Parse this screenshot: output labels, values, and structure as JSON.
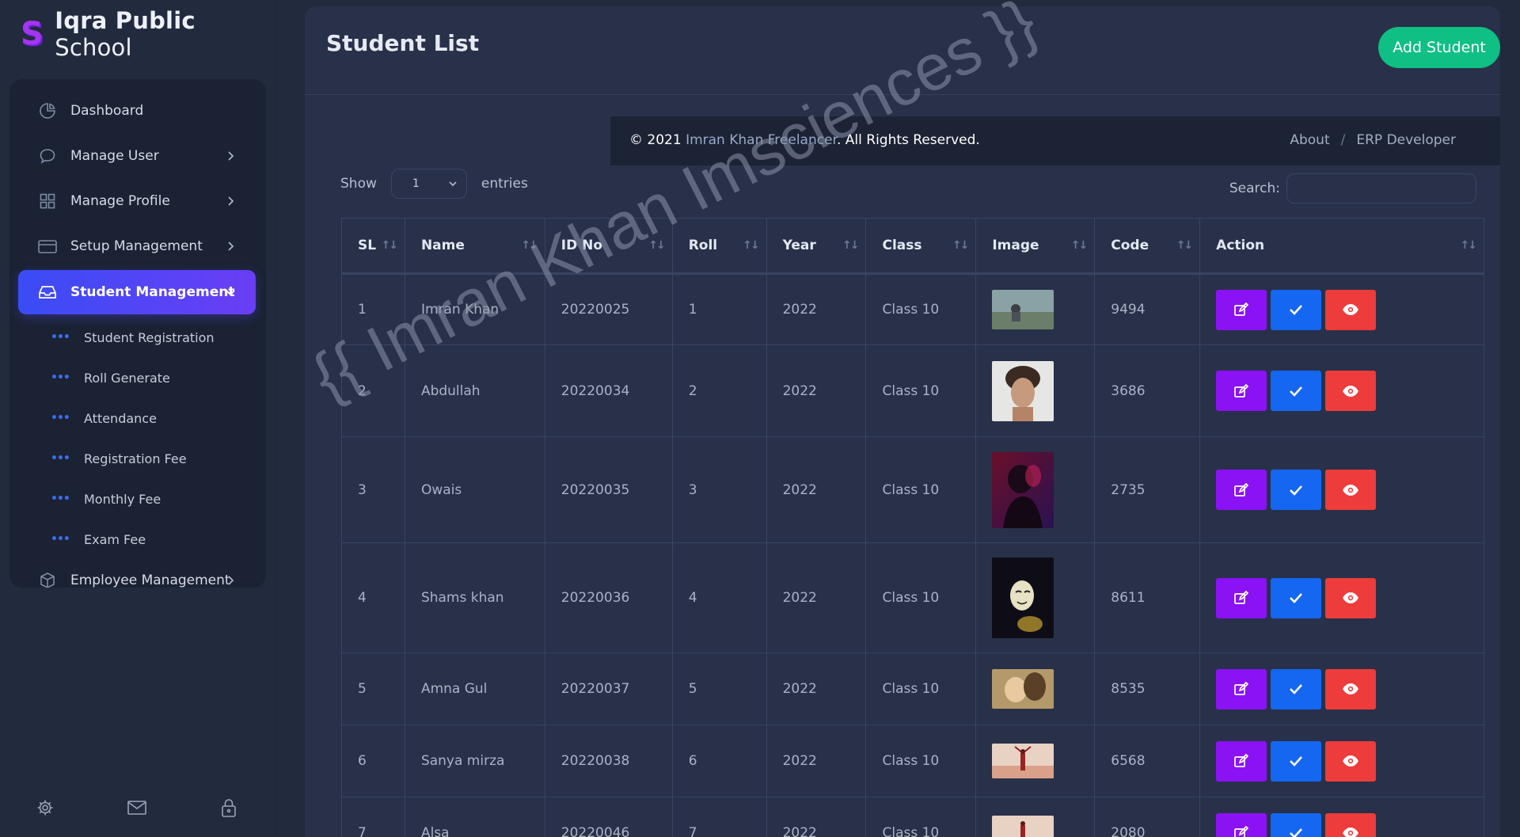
{
  "brand": {
    "logo_letter": "S",
    "name_bold": "Iqra Public",
    "name_light": " School"
  },
  "sidebar": {
    "items": [
      {
        "label": "Dashboard",
        "icon": "pie-chart-icon"
      },
      {
        "label": "Manage User",
        "icon": "chat-bubble-icon"
      },
      {
        "label": "Manage Profile",
        "icon": "grid-icon"
      },
      {
        "label": "Setup Management",
        "icon": "credit-card-icon"
      },
      {
        "label": "Student Management",
        "icon": "inbox-icon"
      },
      {
        "label": "Employee Management",
        "icon": "box-icon"
      }
    ],
    "subitems": [
      "Student Registration",
      "Roll Generate",
      "Attendance",
      "Registration Fee",
      "Monthly Fee",
      "Exam Fee"
    ],
    "bottom_icons": [
      "settings-icon",
      "mail-icon",
      "lock-icon"
    ]
  },
  "header": {
    "title": "Student List",
    "add_button": "Add Student"
  },
  "footer": {
    "copy_prefix": "© 2021 ",
    "copy_link": "Imran Khan Freelancer",
    "copy_suffix": ". All Rights Reserved.",
    "about": "About",
    "sep": "/",
    "erp": "ERP Developer"
  },
  "controls": {
    "show_label": "Show",
    "entries_value": "1",
    "entries_label": "entries",
    "search_label": "Search:"
  },
  "table": {
    "columns": [
      "SL",
      "Name",
      "ID No",
      "Roll",
      "Year",
      "Class",
      "Image",
      "Code",
      "Action"
    ],
    "rows": [
      {
        "sl": "1",
        "name": "Imran Khan",
        "id": "20220025",
        "roll": "1",
        "year": "2022",
        "class": "Class 10",
        "code": "9494"
      },
      {
        "sl": "2",
        "name": "Abdullah",
        "id": "20220034",
        "roll": "2",
        "year": "2022",
        "class": "Class 10",
        "code": "3686"
      },
      {
        "sl": "3",
        "name": "Owais",
        "id": "20220035",
        "roll": "3",
        "year": "2022",
        "class": "Class 10",
        "code": "2735"
      },
      {
        "sl": "4",
        "name": "Shams khan",
        "id": "20220036",
        "roll": "4",
        "year": "2022",
        "class": "Class 10",
        "code": "8611"
      },
      {
        "sl": "5",
        "name": "Amna Gul",
        "id": "20220037",
        "roll": "5",
        "year": "2022",
        "class": "Class 10",
        "code": "8535"
      },
      {
        "sl": "6",
        "name": "Sanya mirza",
        "id": "20220038",
        "roll": "6",
        "year": "2022",
        "class": "Class 10",
        "code": "6568"
      },
      {
        "sl": "7",
        "name": "Alsa",
        "id": "20220046",
        "roll": "7",
        "year": "2022",
        "class": "Class 10",
        "code": "2080"
      }
    ]
  },
  "watermark": "{{ Imran Khan Imsciences }}",
  "colors": {
    "accent_green": "#0fbf84",
    "active_gradient_start": "#3a4cf5",
    "active_gradient_end": "#6a3ef5",
    "edit": "#8a12f5",
    "approve": "#1566f0",
    "view": "#ee3b3b"
  }
}
